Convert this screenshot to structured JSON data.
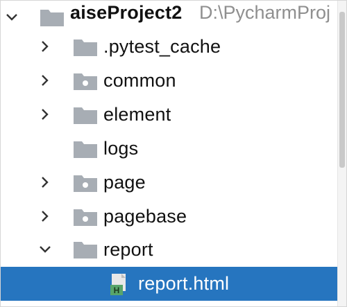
{
  "project_tree": {
    "root": {
      "name": "aiseProject2",
      "path": "D:\\PycharmProj",
      "expanded": true,
      "icon": "folder-icon"
    },
    "items": [
      {
        "label": ".pytest_cache",
        "expanded": false,
        "icon": "folder-icon"
      },
      {
        "label": "common",
        "expanded": false,
        "icon": "package-folder-icon"
      },
      {
        "label": "element",
        "expanded": false,
        "icon": "folder-icon"
      },
      {
        "label": "logs",
        "expanded": null,
        "icon": "folder-icon"
      },
      {
        "label": "page",
        "expanded": false,
        "icon": "package-folder-icon"
      },
      {
        "label": "pagebase",
        "expanded": false,
        "icon": "package-folder-icon"
      },
      {
        "label": "report",
        "expanded": true,
        "icon": "folder-icon"
      },
      {
        "label": "report.html",
        "expanded": null,
        "icon": "html-file-icon",
        "selected": true
      }
    ]
  },
  "colors": {
    "selection": "#2675bf",
    "folder": "#a7adb4",
    "text": "#111111",
    "path_text": "#8f8f8f",
    "html_icon": "#58a56a"
  }
}
